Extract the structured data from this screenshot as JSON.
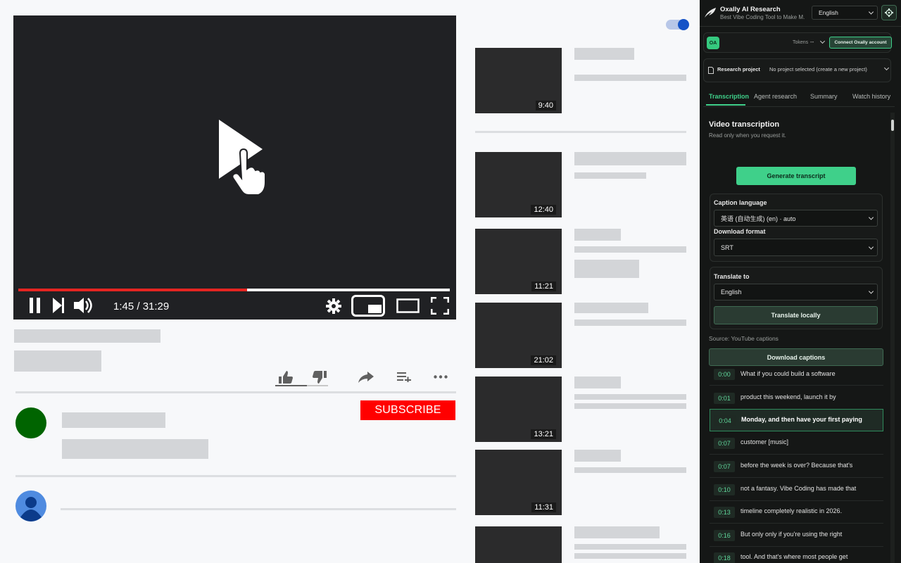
{
  "player": {
    "time": "1:45 / 31:29",
    "progress_fraction": 0.53
  },
  "videos": [
    {
      "duration": "9:40"
    },
    {
      "duration": "12:40"
    },
    {
      "duration": "11:21"
    },
    {
      "duration": "21:02"
    },
    {
      "duration": "13:21"
    },
    {
      "duration": "11:31"
    },
    {
      "duration": ""
    }
  ],
  "channel": {
    "subscribe_label": "SUBSCRIBE"
  },
  "colors": {
    "accent": "#3fd08a",
    "youtube_red": "#ff0000",
    "panel_bg": "#151716"
  },
  "panel": {
    "brand": "Oxally AI Research",
    "tagline": "Best Vibe Coding Tool to Make M...",
    "language": "English",
    "avatar_initials": "OA",
    "tokens_label": "Tokens",
    "tokens_value": "--",
    "connect_label": "Connect Oxally account",
    "project_label": "Research project",
    "project_value": "No project selected (create a new project)",
    "tabs": [
      "Transcription",
      "Agent research",
      "Summary",
      "Watch history"
    ],
    "section_title": "Video transcription",
    "section_sub": "Read only when you request it.",
    "generate_label": "Generate transcript",
    "caption_language_label": "Caption language",
    "caption_language_value": "英语 (自动生成) (en) · auto",
    "download_format_label": "Download format",
    "download_format_value": "SRT",
    "translate_to_label": "Translate to",
    "translate_to_value": "English",
    "translate_button": "Translate locally",
    "source_text": "Source: YouTube captions",
    "download_button": "Download captions",
    "captions": [
      {
        "time": "0:00",
        "text": "What if you could build a software"
      },
      {
        "time": "0:01",
        "text": "product this weekend, launch it by"
      },
      {
        "time": "0:04",
        "text": "Monday, and then have your first paying"
      },
      {
        "time": "0:07",
        "text": "customer [music]"
      },
      {
        "time": "0:07",
        "text": "before the week is over? Because that's"
      },
      {
        "time": "0:10",
        "text": "not a fantasy. Vibe Coding has made that"
      },
      {
        "time": "0:13",
        "text": "timeline completely realistic in 2026."
      },
      {
        "time": "0:16",
        "text": "But only only if you're using the right"
      },
      {
        "time": "0:18",
        "text": "tool. And that's where most people get"
      }
    ]
  }
}
